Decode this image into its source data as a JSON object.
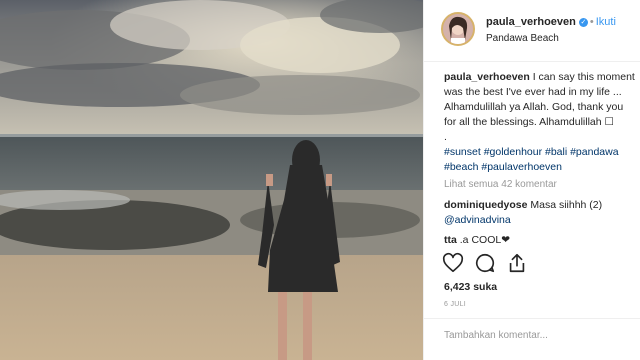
{
  "post": {
    "image_description_icon": "beach-photo",
    "username": "paula_verhoeven",
    "verified_icon": "check-badge-icon",
    "separator": "•",
    "follow_label": "Ikuti",
    "location": "Pandawa Beach",
    "caption_username": "paula_verhoeven",
    "caption_text": "I can say this moment was the best I've ever had in my life ... Alhamdulillah ya Allah. God, thank you for all the blessings. Alhamdulillah ☐",
    "caption_dot": ".",
    "hashtags": "#sunset #goldenhour #bali #pandawa #beach #paulaverhoeven",
    "view_all_comments": "Lihat semua 42 komentar",
    "comments": [
      {
        "username": "dominiquedyose",
        "text": "Masa siihhh (2)",
        "mention": "@advinadvina"
      },
      {
        "username": "tta",
        "text": ".a COOL❤"
      }
    ],
    "likes": "6,423 suka",
    "date": "6 JULI",
    "comment_placeholder": "Tambahkan komentar..."
  },
  "colors": {
    "link": "#3897f0",
    "hashtag": "#003569",
    "muted": "#999999"
  }
}
